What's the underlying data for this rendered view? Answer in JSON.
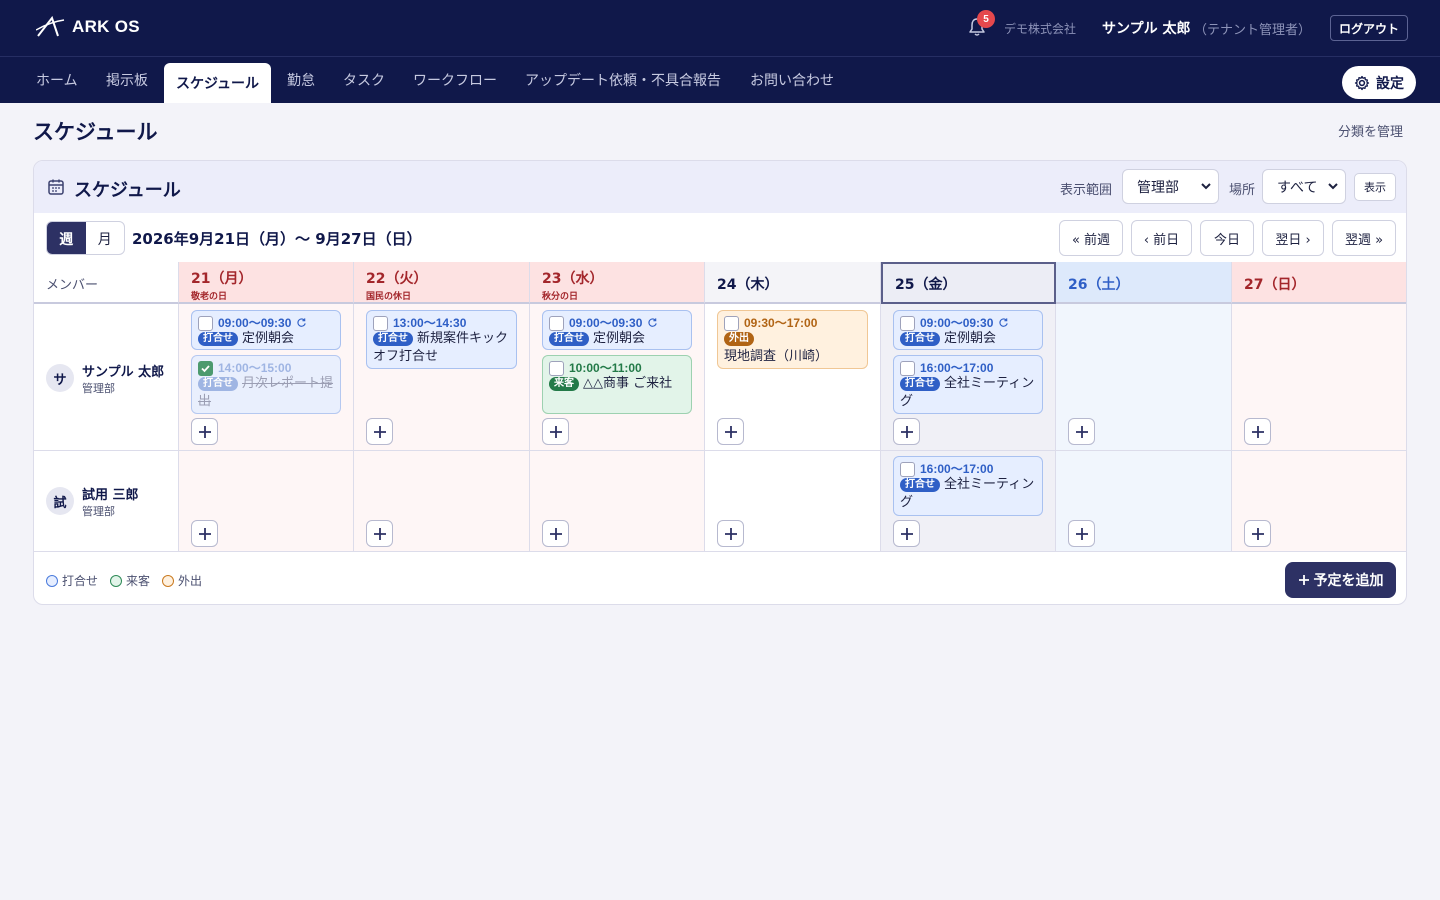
{
  "header": {
    "logo_text": "ARK OS",
    "notification_count": "5",
    "company": "デモ株式会社",
    "user_name": "サンプル 太郎",
    "user_role": "（テナント管理者）",
    "logout_label": "ログアウト"
  },
  "nav": {
    "items": [
      {
        "label": "ホーム"
      },
      {
        "label": "掲示板"
      },
      {
        "label": "スケジュール"
      },
      {
        "label": "勤怠"
      },
      {
        "label": "タスク"
      },
      {
        "label": "ワークフロー"
      },
      {
        "label": "アップデート依頼・不具合報告"
      },
      {
        "label": "お問い合わせ"
      }
    ],
    "active": "スケジュール",
    "settings_label": "設定"
  },
  "page": {
    "title": "スケジュール",
    "manage_link": "分類を管理"
  },
  "card": {
    "title": "スケジュール",
    "range_label": "表示範囲",
    "range_value": "管理部",
    "place_label": "場所",
    "place_value": "すべて",
    "show_button": "表示",
    "view_week": "週",
    "view_month": "月",
    "date_range": "2026年9月21日（月）〜 9月27日（日）",
    "nav_buttons": {
      "prev_week": "« 前週",
      "prev_day": "‹ 前日",
      "today": "今日",
      "next_day": "翌日 ›",
      "next_week": "翌週 »"
    },
    "member_header": "メンバー",
    "days": [
      {
        "label": "21（月）",
        "holiday": "敬老の日"
      },
      {
        "label": "22（火）",
        "holiday": "国民の休日"
      },
      {
        "label": "23（水）",
        "holiday": "秋分の日"
      },
      {
        "label": "24（木）",
        "holiday": ""
      },
      {
        "label": "25（金）",
        "holiday": ""
      },
      {
        "label": "26（土）",
        "holiday": ""
      },
      {
        "label": "27（日）",
        "holiday": ""
      }
    ],
    "members": [
      {
        "initial": "サ",
        "name": "サンプル 太郎",
        "dept": "管理部"
      },
      {
        "initial": "試",
        "name": "試用 三郎",
        "dept": "管理部"
      }
    ],
    "events": {
      "e0": {
        "time": "09:00〜09:30",
        "tag": "打合せ",
        "title": "定例朝会",
        "repeat": true,
        "done": false
      },
      "e1": {
        "time": "14:00〜15:00",
        "tag": "打合せ",
        "title": "月次レポート提出",
        "done": true
      },
      "e2": {
        "time": "13:00〜14:30",
        "tag": "打合せ",
        "title": "新規案件キックオフ打合せ",
        "done": false
      },
      "e3": {
        "time": "09:00〜09:30",
        "tag": "打合せ",
        "title": "定例朝会",
        "repeat": true,
        "done": false
      },
      "e4": {
        "time": "10:00〜11:00",
        "tag": "来客",
        "title": "△△商事 ご来社",
        "done": false
      },
      "e5": {
        "time": "09:30〜17:00",
        "tag": "外出",
        "title": "現地調査（川崎）",
        "done": false
      },
      "e6": {
        "time": "09:00〜09:30",
        "tag": "打合せ",
        "title": "定例朝会",
        "repeat": true,
        "done": false
      },
      "e7": {
        "time": "16:00〜17:00",
        "tag": "打合せ",
        "title": "全社ミーティング",
        "done": false
      },
      "e8": {
        "time": "16:00〜17:00",
        "tag": "打合せ",
        "title": "全社ミーティング",
        "done": false
      }
    },
    "legend": [
      {
        "label": "打合せ",
        "color": "#4a7bdc"
      },
      {
        "label": "来客",
        "color": "#2e8a57"
      },
      {
        "label": "外出",
        "color": "#c97a20"
      }
    ],
    "add_button": "予定を追加"
  },
  "colors": {
    "header_bg": "#10184a",
    "holiday_bg": "#fde2e2",
    "saturday_bg": "#dde9fb",
    "today_bg": "#ecedf5",
    "primary_button": "#2d3164"
  }
}
